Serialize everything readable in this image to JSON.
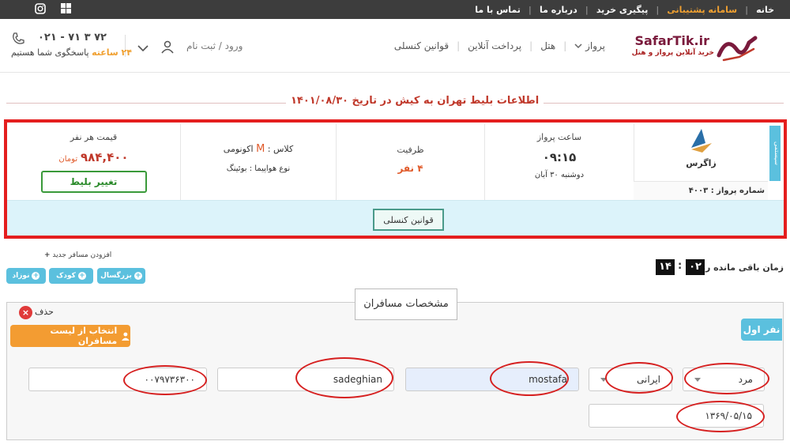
{
  "topbar": {
    "links": [
      "خانه",
      "سامانه پشتیبانی",
      "پیگیری خرید",
      "درباره ما",
      "تماس با ما"
    ],
    "accent_index": 1,
    "social_icons": [
      "windows-icon",
      "instagram-icon"
    ]
  },
  "header": {
    "logo_text": "SafarTik.ir",
    "logo_sub": "خرید آنلاین پرواز و هتل",
    "nav": [
      "پرواز",
      "هتل",
      "پرداخت آنلاین",
      "قوانین کنسلی"
    ],
    "login": "ورود / ثبت نام",
    "phone": "۰۲۱ - ۷۱ ۳ ۷۲",
    "support_hours": "۲۴ ساعته",
    "support_text": "پاسخگوی شما هستیم"
  },
  "page_title": "اطلاعات بلیط تهران به کیش در تاریخ ۱۴۰۱/۰۸/۳۰",
  "flight": {
    "side_tab": "سیستمی",
    "airline": "زاگرس",
    "flight_number_label": "شماره پرواز :",
    "flight_number": "۴۰۰۳",
    "time_label": "ساعت پرواز",
    "time": "۰۹:۱۵",
    "date": "دوشنبه ۳۰ آبان",
    "capacity_label": "ظرفیت",
    "capacity": "۴ نفر",
    "class_label": "کلاس :",
    "class_code": "M",
    "class_name": "اکونومی",
    "aircraft_label": "نوع هواپیما :",
    "aircraft": "بوئینگ",
    "price_label": "قیمت هر نفر",
    "price": "۹۸۴,۴۰۰",
    "currency": "تومان",
    "change_button": "تغییر بلیط",
    "cancel_rules_button": "قوانین کنسلی",
    "colors": {
      "highlight_border": "#e41e1e",
      "strip": "#dcf3fa"
    }
  },
  "timer": {
    "label": "زمان باقی مانده رزرو",
    "minutes": "۰۲",
    "seconds": "۱۴",
    "separator": ":"
  },
  "add_passenger": {
    "label": "افزودن مسافر جدید",
    "adult": "بزرگسال",
    "child": "کودک",
    "infant": "نوزاد"
  },
  "passengers": {
    "section_title": "مشخصات مسافران",
    "remove_label": "حذف",
    "select_from_list": "انتخاب از لیست مسافران",
    "first": {
      "label": "نفر اول",
      "gender": "مرد",
      "nationality": "ایرانی",
      "first_name": "mostafa",
      "last_name": "sadeghian",
      "national_code": "۰۰۷۹۷۳۶۳۰۰",
      "birth_date": "۱۳۶۹/۰۵/۱۵"
    }
  }
}
